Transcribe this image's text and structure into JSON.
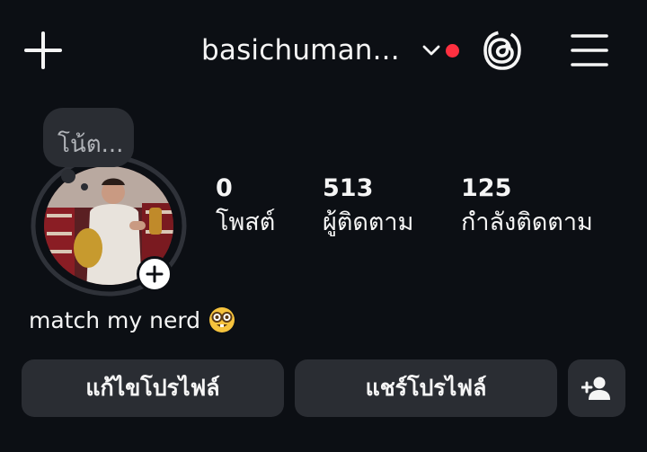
{
  "header": {
    "username": "basichuman...",
    "icons": [
      "plus-icon",
      "chevron-down-icon",
      "threads-icon",
      "menu-icon"
    ],
    "notification_dot_color": "#ff3040"
  },
  "note": {
    "placeholder": "โน้ต..."
  },
  "stats": [
    {
      "value": "0",
      "label": "โพสต์"
    },
    {
      "value": "513",
      "label": "ผู้ติดตาม"
    },
    {
      "value": "125",
      "label": "กำลังติดตาม"
    }
  ],
  "bio": {
    "text": "match my nerd",
    "emoji": "nerd-face-emoji"
  },
  "buttons": {
    "edit_profile": "แก้ไขโปรไฟล์",
    "share_profile": "แชร์โปรไฟล์",
    "add_person_icon": "add-person-icon"
  },
  "colors": {
    "background": "#0c0f14",
    "button_bg": "#2a2d33",
    "text": "#f5f5f5"
  }
}
